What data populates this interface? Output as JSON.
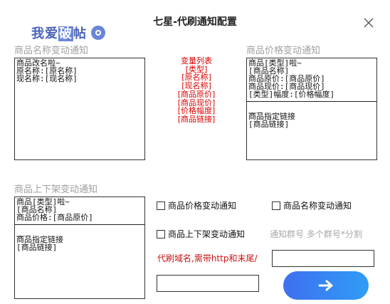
{
  "window": {
    "title": "七星-代刷通知配置"
  },
  "logo": {
    "text_a": "我爱",
    "text_b": "破",
    "text_c": "帖"
  },
  "sections": {
    "name_change": {
      "label": "商品名称变动通知",
      "lines": [
        "商品改名啦~",
        "原名称:[原名称]",
        "现名称:[现名称]"
      ]
    },
    "price_change": {
      "label": "商品价格变动通知",
      "lines": [
        "商品[类型]啦~",
        "[商品名称]",
        "商品原价:[商品原价]",
        "商品现价:[商品现价]",
        "[类型]幅度:[价格幅度]"
      ],
      "dash": "___",
      "tail": [
        "商品指定链接",
        "[商品链接]"
      ]
    },
    "shelf_change": {
      "label": "商品上下架变动通知",
      "lines": [
        "商品[类型]啦~",
        "[商品名称]",
        "商品价格:[商品原价]"
      ],
      "dash": "___",
      "tail": [
        "商品指定链接",
        "[商品链接]"
      ]
    }
  },
  "variables": {
    "title": "变量列表",
    "items": [
      "[类型]",
      "[原名称]",
      "[现名称]",
      "[商品原价]",
      "[商品现价]",
      "[价格幅度]",
      "[商品链接]"
    ]
  },
  "checkboxes": {
    "price": {
      "label": "商品价格变动通知",
      "checked": false
    },
    "name": {
      "label": "商品名称变动通知",
      "checked": false
    },
    "shelf": {
      "label": "商品上下架变动通知",
      "checked": false
    }
  },
  "group_hint": "通知群号 多个群号*分割",
  "domain_hint": "代刷域名,需带http和末尾/",
  "group_input": {
    "value": ""
  },
  "domain_input": {
    "value": ""
  },
  "icons": {
    "close": "close-icon",
    "submit": "arrow-right-icon",
    "logo": "logo-icon"
  },
  "colors": {
    "accent": "#3f6ff0",
    "accent2": "#2f9df5",
    "variable_red": "#dd0000"
  }
}
